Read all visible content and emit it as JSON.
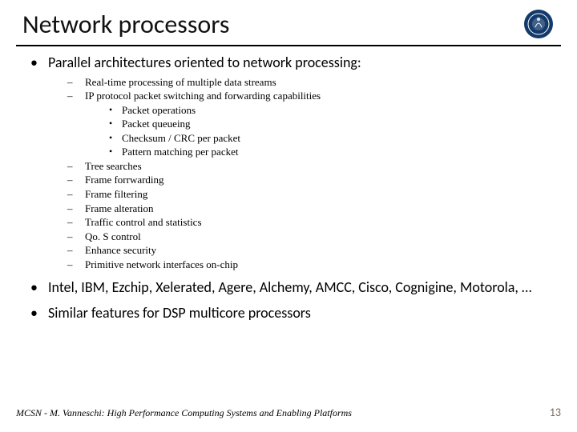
{
  "title": "Network processors",
  "bullets": [
    {
      "text": "Parallel architectures oriented to network processing:",
      "sub": [
        {
          "text": "Real-time processing of multiple data streams"
        },
        {
          "text": "IP protocol packet switching and forwarding capabilities",
          "sub": [
            {
              "text": "Packet operations"
            },
            {
              "text": "Packet queueing"
            },
            {
              "text": "Checksum / CRC per packet"
            },
            {
              "text": "Pattern matching per packet"
            }
          ]
        },
        {
          "text": "Tree searches"
        },
        {
          "text": "Frame forrwarding"
        },
        {
          "text": "Frame filtering"
        },
        {
          "text": "Frame alteration"
        },
        {
          "text": "Traffic control and statistics"
        },
        {
          "text": "Qo. S control"
        },
        {
          "text": "Enhance security"
        },
        {
          "text": "Primitive network interfaces on-chip"
        }
      ]
    },
    {
      "text": "Intel, IBM, Ezchip, Xelerated, Agere, Alchemy, AMCC, Cisco, Cognigine, Motorola, …"
    },
    {
      "text": "Similar features for DSP multicore processors"
    }
  ],
  "footer_left": "MCSN  -   M. Vanneschi: High Performance Computing Systems and Enabling Platforms",
  "page_number": "13"
}
